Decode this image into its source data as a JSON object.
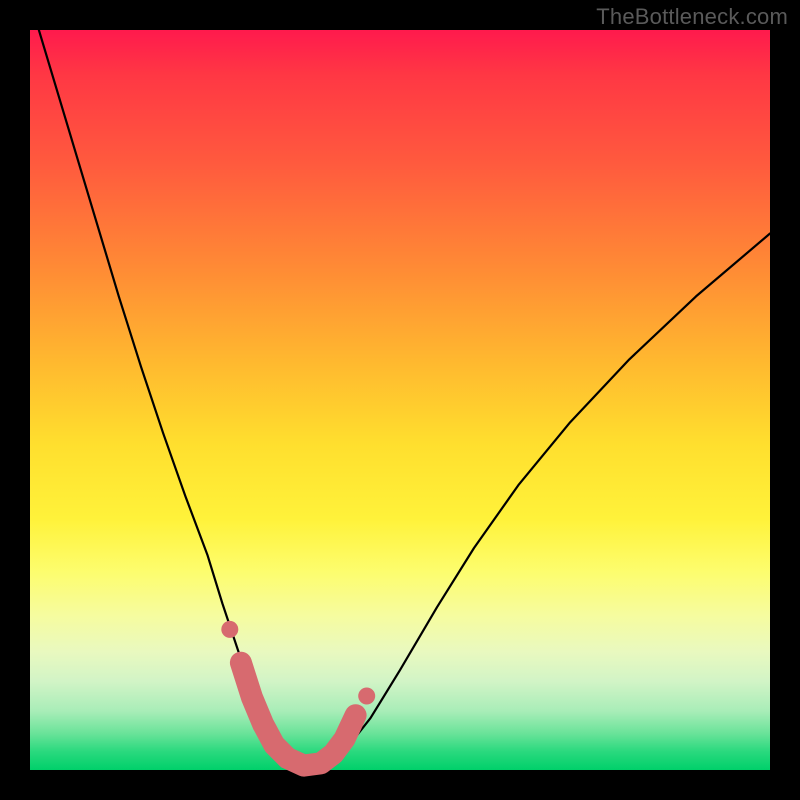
{
  "watermark": "TheBottleneck.com",
  "colors": {
    "frame": "#000000",
    "curve": "#000000",
    "marker_fill": "#d76a6f",
    "marker_stroke": "#c95a60",
    "gradient_top": "#ff1a4d",
    "gradient_bottom": "#00d06a"
  },
  "chart_data": {
    "type": "line",
    "title": "",
    "xlabel": "",
    "ylabel": "",
    "xlim": [
      0,
      100
    ],
    "ylim": [
      0,
      100
    ],
    "grid": false,
    "series": [
      {
        "name": "bottleneck-curve",
        "x": [
          0,
          3,
          6,
          9,
          12,
          15,
          18,
          21,
          24,
          26,
          28,
          29.5,
          31,
          32.5,
          34,
          35.5,
          37,
          38.5,
          40,
          43,
          46,
          50,
          55,
          60,
          66,
          73,
          81,
          90,
          100
        ],
        "values": [
          104,
          94,
          84,
          74,
          64,
          54.5,
          45.5,
          37,
          29,
          22.5,
          16.5,
          12,
          8,
          4.8,
          2.5,
          1.2,
          0.6,
          0.6,
          1.0,
          3.2,
          7.0,
          13.5,
          22,
          30,
          38.5,
          47,
          55.5,
          64,
          72.5
        ]
      }
    ],
    "markers": {
      "name": "highlighted-points",
      "x": [
        28.5,
        30.0,
        31.5,
        33.0,
        34.8,
        37.0,
        39.3,
        41.0,
        42.5,
        44.0
      ],
      "values": [
        14.5,
        9.8,
        6.2,
        3.4,
        1.6,
        0.6,
        0.9,
        2.2,
        4.2,
        7.4
      ],
      "end_dots": {
        "x": [
          27.0,
          45.5
        ],
        "values": [
          19.0,
          10.0
        ]
      }
    }
  }
}
